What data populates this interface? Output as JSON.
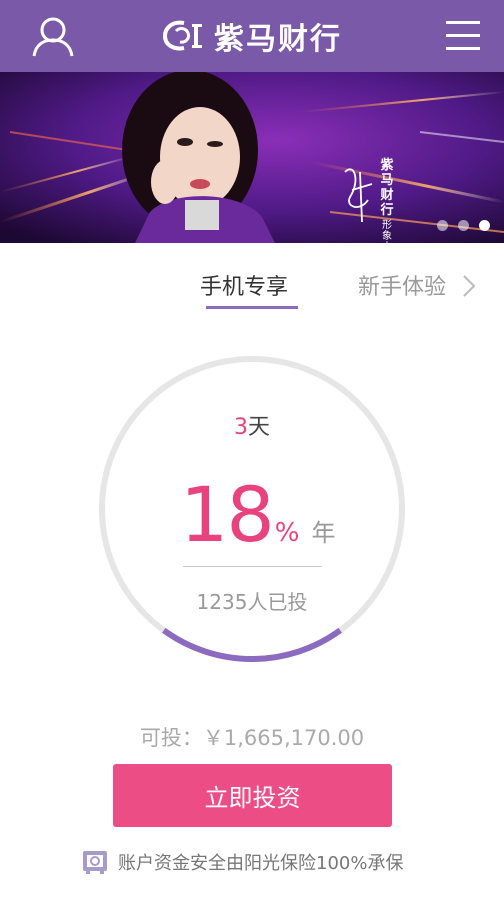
{
  "header": {
    "brand_name": "紫马财行",
    "user_icon": "user-icon",
    "menu_icon": "hamburger-menu-icon"
  },
  "banner": {
    "vertical_title": "紫马财行",
    "vertical_sub": "形象大使",
    "slides_total": 3,
    "active_slide": 3
  },
  "tabs": {
    "active_label": "手机专享",
    "next_label": "新手体验"
  },
  "product": {
    "days_value": "3",
    "days_unit": "天",
    "rate_value": "18",
    "rate_symbol": "%",
    "rate_unit": "年",
    "investors": "1235人已投",
    "progress_fraction": 0.2
  },
  "available": "可投：￥1,665,170.00",
  "invest_button": "立即投资",
  "safety_note": "账户资金安全由阳光保险100%承保",
  "colors": {
    "header": "#7b59a9",
    "accent_pink": "#e8437c",
    "button": "#ec4d84",
    "progress": "#8c6ac0",
    "ring": "#e6e6e6"
  }
}
